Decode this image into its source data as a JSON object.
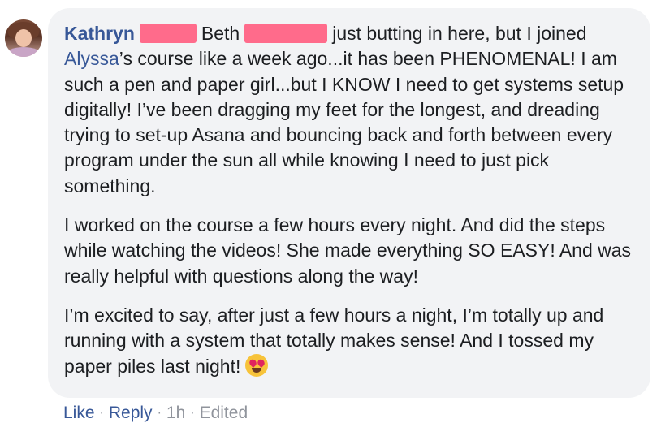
{
  "comment": {
    "author": "Kathryn",
    "author_middle": "Beth",
    "line1_rest": "just butting in here, but I joined",
    "mention": "Alyssa",
    "p1_after_mention": "’s course like a week ago...it has been PHENOMENAL! I am such a pen and paper girl...but I KNOW I need to get systems setup digitally! I’ve been dragging my feet for the longest, and dreading trying to set-up Asana and bouncing back and forth between every program under the sun all while knowing I need to just pick something.",
    "p2": "I worked on the course a few hours every night. And did the steps while watching the videos! She made everything SO EASY! And was really helpful with questions along the way!",
    "p3": "I’m excited to say, after just a few hours a night, I’m totally up and running with a system that totally makes sense! And I tossed my paper piles last night!",
    "emoji": "heart-eyes-emoji"
  },
  "actions": {
    "like": "Like",
    "separator": "·",
    "reply": "Reply",
    "time": "1h",
    "edited": "Edited"
  },
  "colors": {
    "bubble": "#f2f3f5",
    "link": "#385898",
    "redaction": "#ff6b8b",
    "meta": "#90949c"
  }
}
